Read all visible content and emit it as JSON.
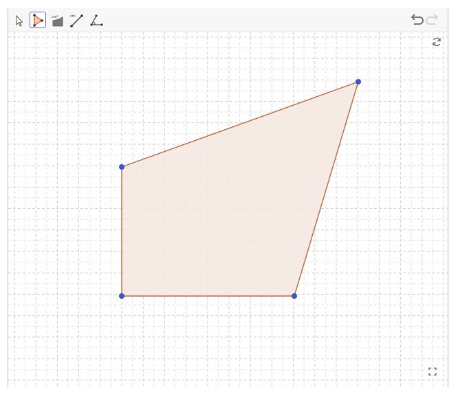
{
  "toolbar": {
    "tools": [
      {
        "icon": "move-arrow-icon",
        "active": false
      },
      {
        "icon": "polygon-tool-icon",
        "active": true
      },
      {
        "icon": "area-measure-icon",
        "active": false
      },
      {
        "icon": "distance-measure-icon",
        "active": false
      },
      {
        "icon": "angle-tool-icon",
        "active": false
      }
    ],
    "undo_icon": "undo-icon",
    "redo_icon": "redo-icon"
  },
  "canvas": {
    "grid": true,
    "polygon": {
      "fill_color": "#f3e6df",
      "stroke_color": "#b9683f",
      "vertex_color": "#3b56e0"
    },
    "reset_icon": "reset-view-icon",
    "fullscreen_icon": "fullscreen-icon"
  }
}
